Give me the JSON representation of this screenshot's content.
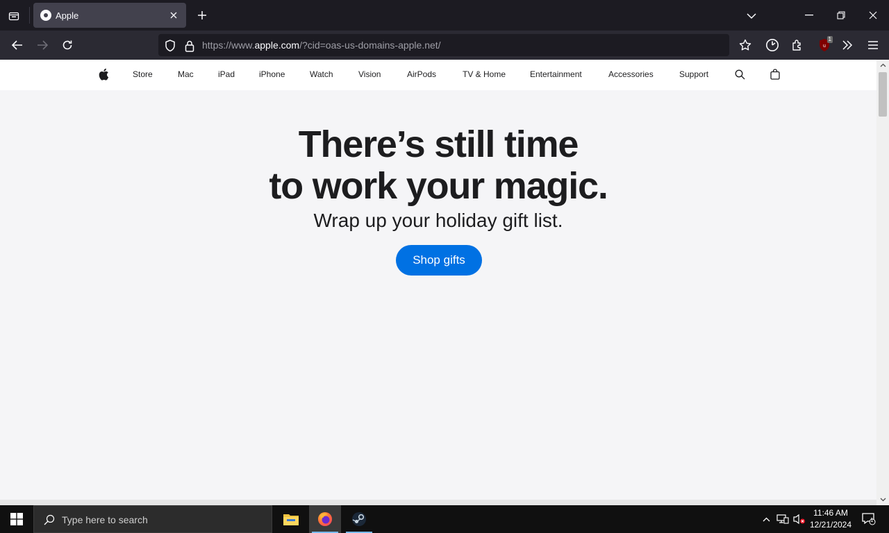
{
  "browser": {
    "tab": {
      "title": "Apple"
    },
    "url": {
      "prefix": "https://www.",
      "domain": "apple.com",
      "suffix": "/?cid=oas-us-domains-apple.net/"
    },
    "extension_badge": "1"
  },
  "apple_nav": {
    "items": [
      "Store",
      "Mac",
      "iPad",
      "iPhone",
      "Watch",
      "Vision",
      "AirPods",
      "TV & Home",
      "Entertainment",
      "Accessories",
      "Support"
    ]
  },
  "hero": {
    "line1": "There’s still time",
    "line2": "to work your magic.",
    "subtitle": "Wrap up your holiday gift list.",
    "cta": "Shop gifts"
  },
  "taskbar": {
    "search_placeholder": "Type here to search",
    "time": "11:46 AM",
    "date": "12/21/2024",
    "notification_count": "1"
  },
  "colors": {
    "accent": "#0071e3",
    "page_bg": "#f5f5f7",
    "browser_bg": "#1c1b22"
  }
}
